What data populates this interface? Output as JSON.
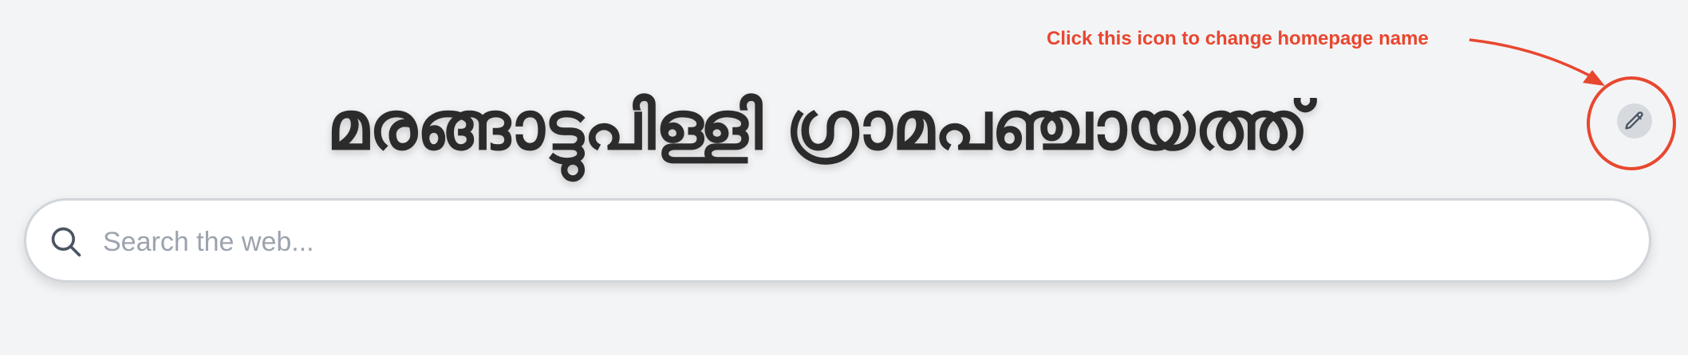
{
  "header": {
    "title": "മരങ്ങാട്ടുപിള്ളി ഗ്രാമപഞ്ചായത്ത്"
  },
  "annotation": {
    "text": "Click this icon to change homepage name",
    "color": "#e8472f"
  },
  "edit_button": {
    "icon": "pencil-icon"
  },
  "search": {
    "icon": "search-icon",
    "placeholder": "Search the web...",
    "value": ""
  }
}
